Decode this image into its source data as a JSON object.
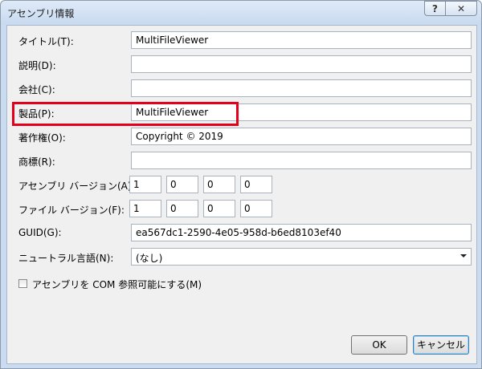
{
  "window": {
    "title": "アセンブリ情報",
    "help_glyph": "?",
    "close_glyph": "✕"
  },
  "fields": {
    "title": {
      "label": "タイトル(T):",
      "value": "MultiFileViewer"
    },
    "description": {
      "label": "説明(D):",
      "value": ""
    },
    "company": {
      "label": "会社(C):",
      "value": ""
    },
    "product": {
      "label": "製品(P):",
      "value": "MultiFileViewer"
    },
    "copyright": {
      "label": "著作権(O):",
      "value": "Copyright ©  2019"
    },
    "trademark": {
      "label": "商標(R):",
      "value": ""
    },
    "assembly_version": {
      "label": "アセンブリ バージョン(A):",
      "parts": [
        "1",
        "0",
        "0",
        "0"
      ]
    },
    "file_version": {
      "label": "ファイル バージョン(F):",
      "parts": [
        "1",
        "0",
        "0",
        "0"
      ]
    },
    "guid": {
      "label": "GUID(G):",
      "value": "ea567dc1-2590-4e05-958d-b6ed8103ef40"
    },
    "neutral_language": {
      "label": "ニュートラル言語(N):",
      "selected": "(なし)"
    }
  },
  "com_visible": {
    "label": "アセンブリを COM 参照可能にする(M)",
    "checked": false
  },
  "buttons": {
    "ok": "OK",
    "cancel": "キャンセル"
  },
  "colors": {
    "highlight": "#e4001b",
    "frame": "#c9dcf1"
  }
}
